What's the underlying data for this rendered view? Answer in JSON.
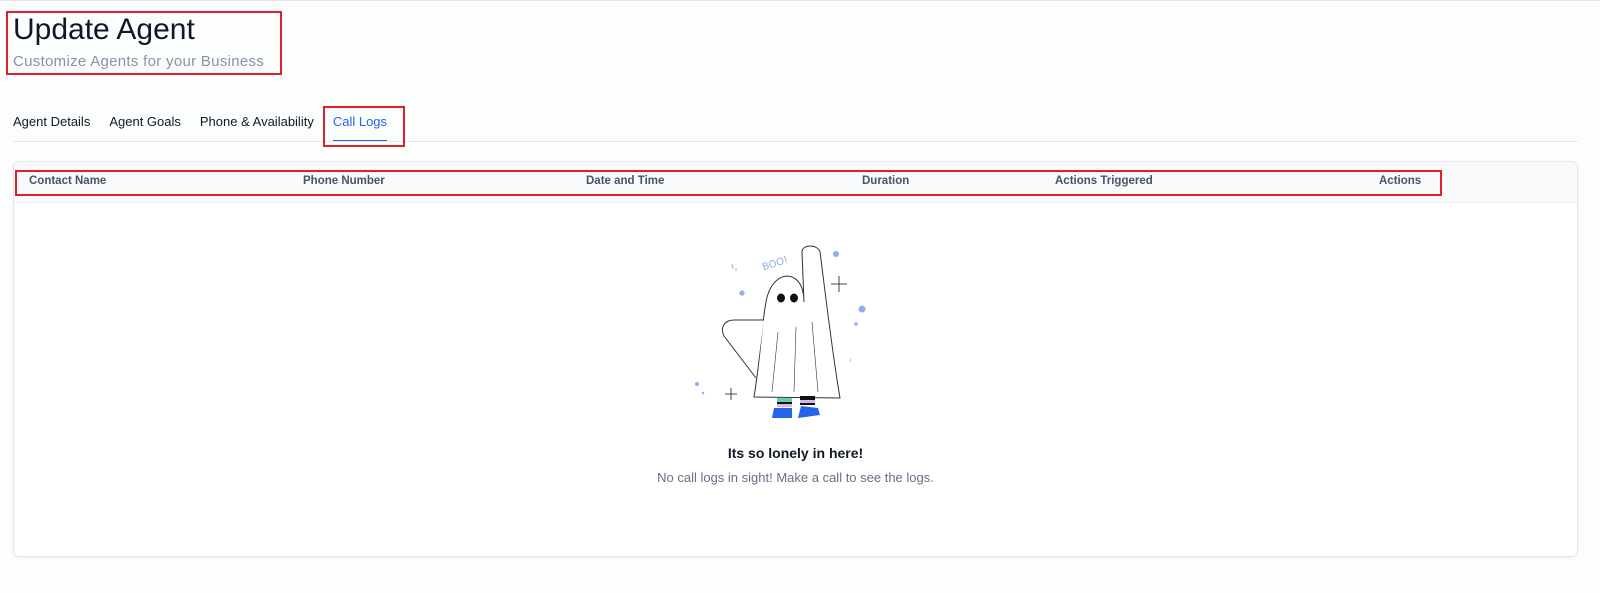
{
  "header": {
    "title": "Update Agent",
    "subtitle": "Customize Agents for your Business"
  },
  "tabs": [
    {
      "label": "Agent Details",
      "active": false
    },
    {
      "label": "Agent Goals",
      "active": false
    },
    {
      "label": "Phone & Availability",
      "active": false
    },
    {
      "label": "Call Logs",
      "active": true
    }
  ],
  "table": {
    "columns": [
      "Contact Name",
      "Phone Number",
      "Date and Time",
      "Duration",
      "Actions Triggered",
      "Actions"
    ],
    "rows": []
  },
  "empty_state": {
    "illustration_icon": "ghost-icon",
    "illustration_text": "BOO!",
    "title": "Its so lonely in here!",
    "message": "No call logs in sight! Make a call to see the logs."
  },
  "colors": {
    "accent": "#2563eb",
    "highlight_box": "#e01f26",
    "illustration_blue": "#8db0f0"
  }
}
